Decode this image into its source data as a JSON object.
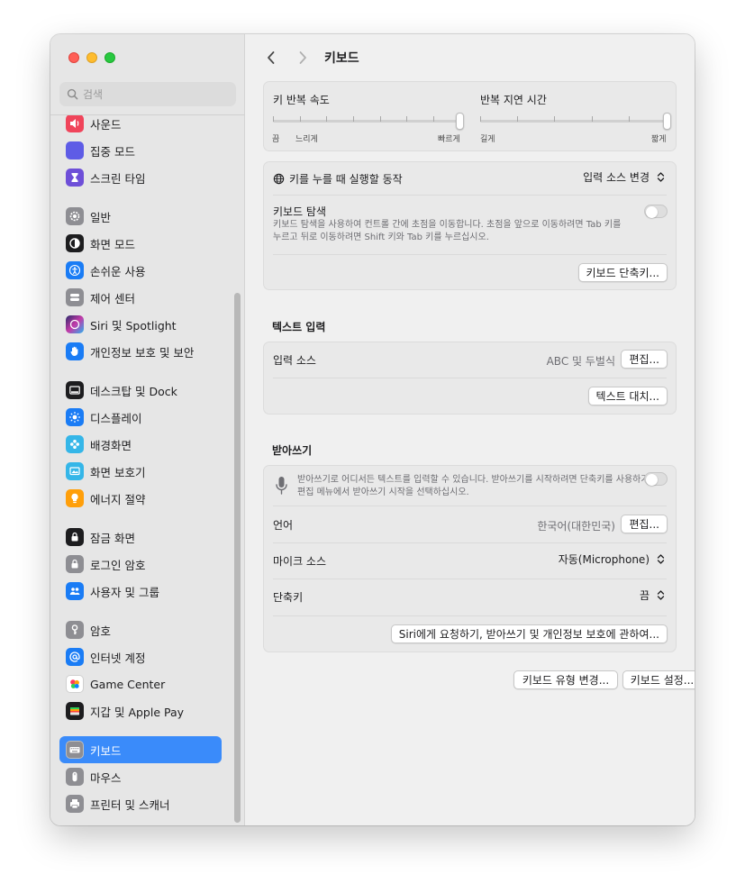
{
  "window": {
    "title": "키보드"
  },
  "search": {
    "placeholder": "검색"
  },
  "sidebar": {
    "items": [
      {
        "label": "사운드",
        "icon": "speaker-icon",
        "color": "#f0445a"
      },
      {
        "label": "집중 모드",
        "icon": "moon-icon",
        "color": "#5e5ce6"
      },
      {
        "label": "스크린 타임",
        "icon": "hourglass-icon",
        "color": "#6e4fd8"
      },
      {
        "label": "일반",
        "icon": "gear-icon",
        "color": "#8e8e93"
      },
      {
        "label": "화면 모드",
        "icon": "appearance-icon",
        "color": "#1d1d1f"
      },
      {
        "label": "손쉬운 사용",
        "icon": "accessibility-icon",
        "color": "#1a7cf5"
      },
      {
        "label": "제어 센터",
        "icon": "control-center-icon",
        "color": "#8e8e93"
      },
      {
        "label": "Siri 및 Spotlight",
        "icon": "siri-icon",
        "color": "#3b3b98"
      },
      {
        "label": "개인정보 보호 및 보안",
        "icon": "hand-icon",
        "color": "#1a7cf5"
      },
      {
        "label": "데스크탑 및 Dock",
        "icon": "dock-icon",
        "color": "#1d1d1f"
      },
      {
        "label": "디스플레이",
        "icon": "display-icon",
        "color": "#1a7cf5"
      },
      {
        "label": "배경화면",
        "icon": "wallpaper-icon",
        "color": "#35b6e8"
      },
      {
        "label": "화면 보호기",
        "icon": "screensaver-icon",
        "color": "#35b6e8"
      },
      {
        "label": "에너지 절약",
        "icon": "lightbulb-icon",
        "color": "#ff9f0a"
      },
      {
        "label": "잠금 화면",
        "icon": "lock-screen-icon",
        "color": "#1d1d1f"
      },
      {
        "label": "로그인 암호",
        "icon": "lock-icon",
        "color": "#8e8e93"
      },
      {
        "label": "사용자 및 그룹",
        "icon": "users-icon",
        "color": "#1a7cf5"
      },
      {
        "label": "암호",
        "icon": "key-icon",
        "color": "#8e8e93"
      },
      {
        "label": "인터넷 계정",
        "icon": "at-icon",
        "color": "#1a7cf5"
      },
      {
        "label": "Game Center",
        "icon": "game-center-icon",
        "color": "#ffffff"
      },
      {
        "label": "지갑 및 Apple Pay",
        "icon": "wallet-icon",
        "color": "#1d1d1f"
      },
      {
        "label": "키보드",
        "icon": "keyboard-icon",
        "color": "#8e8e93"
      },
      {
        "label": "마우스",
        "icon": "mouse-icon",
        "color": "#8e8e93"
      },
      {
        "label": "프린터 및 스캐너",
        "icon": "printer-icon",
        "color": "#8e8e93"
      }
    ]
  },
  "key_repeat": {
    "rate_label": "키 반복 속도",
    "rate_ticks": [
      "끔",
      "느리게",
      "빠르게"
    ],
    "rate_value": 1.0,
    "delay_label": "반복 지연 시간",
    "delay_ticks": [
      "길게",
      "짧게"
    ],
    "delay_value": 1.0
  },
  "globe_key": {
    "label": "키를 누를 때 실행할 동작",
    "value": "입력 소스 변경"
  },
  "keyboard_nav": {
    "label": "키보드 탐색",
    "desc_line1": "키보드 탐색을 사용하여 컨트롤 간에 초점을 이동합니다. 초점을 앞으로 이동하려면 Tab 키를",
    "desc_line2": "누르고 뒤로 이동하려면 Shift 키와 Tab 키를 누르십시오.",
    "enabled": false
  },
  "shortcuts_button": "키보드 단축키...",
  "text_input": {
    "section_title": "텍스트 입력",
    "source_label": "입력 소스",
    "source_value": "ABC 및 두벌식",
    "edit_button": "편집...",
    "replace_button": "텍스트 대치..."
  },
  "dictation": {
    "section_title": "받아쓰기",
    "desc_line1": "받아쓰기로 어디서든 텍스트를 입력할 수 있습니다. 받아쓰기를 시작하려면 단축키를 사용하거나",
    "desc_line2": "편집 메뉴에서 받아쓰기 시작을 선택하십시오.",
    "enabled": false,
    "language_label": "언어",
    "language_value": "한국어(대한민국)",
    "edit_button": "편집...",
    "mic_label": "마이크 소스",
    "mic_value": "자동(Microphone)",
    "shortcut_label": "단축키",
    "shortcut_value": "끔",
    "privacy_button": "Siri에게 요청하기, 받아쓰기 및 개인정보 보호에 관하여..."
  },
  "footer": {
    "change_type_button": "키보드 유형 변경...",
    "setup_button": "키보드 설정...",
    "help_button": "?"
  }
}
